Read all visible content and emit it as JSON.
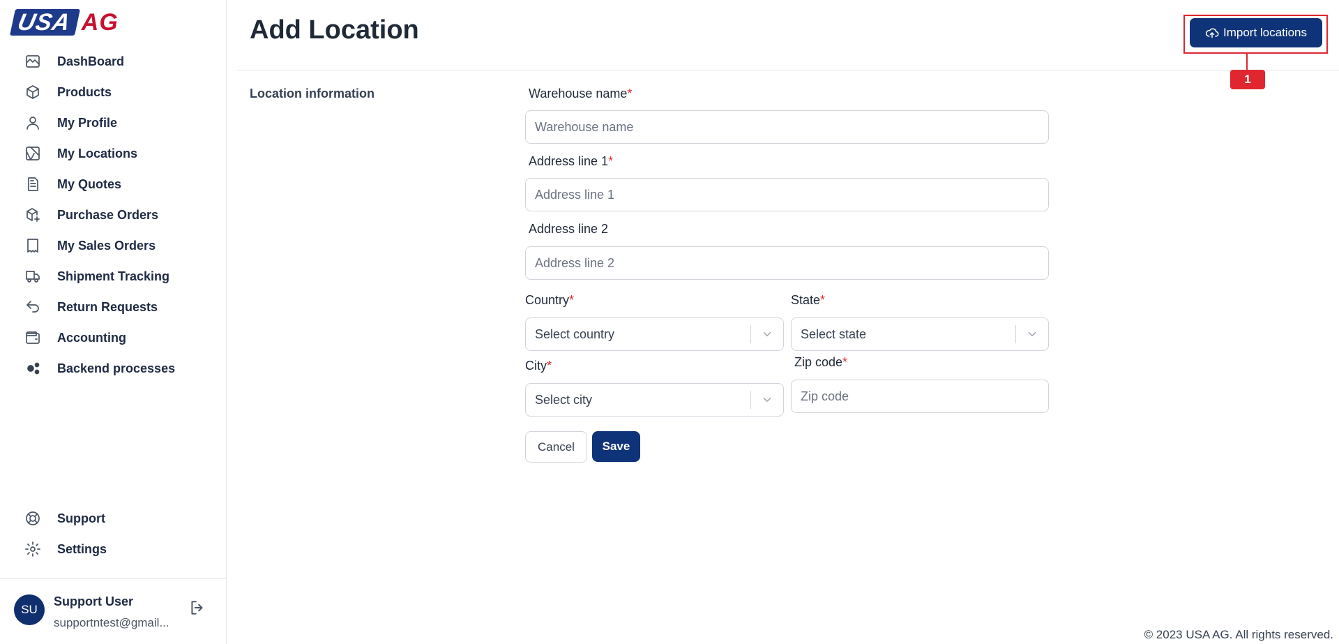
{
  "brand": {
    "logo_left": "USA",
    "logo_right": "AG"
  },
  "sidebar": {
    "items": [
      {
        "label": "DashBoard",
        "icon": "chart-line-icon"
      },
      {
        "label": "Products",
        "icon": "cube-icon"
      },
      {
        "label": "My Profile",
        "icon": "user-icon"
      },
      {
        "label": "My Locations",
        "icon": "map-icon"
      },
      {
        "label": "My Quotes",
        "icon": "document-icon"
      },
      {
        "label": "Purchase Orders",
        "icon": "package-plus-icon"
      },
      {
        "label": "My Sales Orders",
        "icon": "receipt-icon"
      },
      {
        "label": "Shipment Tracking",
        "icon": "truck-icon"
      },
      {
        "label": "Return Requests",
        "icon": "return-arrow-icon"
      },
      {
        "label": "Accounting",
        "icon": "wallet-icon"
      },
      {
        "label": "Backend processes",
        "icon": "gears-icon"
      }
    ],
    "bottom_items": [
      {
        "label": "Support",
        "icon": "lifebuoy-icon"
      },
      {
        "label": "Settings",
        "icon": "gear-icon"
      }
    ],
    "user": {
      "initials": "SU",
      "name": "Support User",
      "email": "supportntest@gmail..."
    }
  },
  "header": {
    "title": "Add Location",
    "import_label": "Import locations",
    "annotation_number": "1"
  },
  "form": {
    "section_label": "Location information",
    "warehouse": {
      "label": "Warehouse name",
      "placeholder": "Warehouse name"
    },
    "address1": {
      "label": "Address line 1",
      "placeholder": "Address line 1"
    },
    "address2": {
      "label": "Address line 2",
      "placeholder": "Address line 2"
    },
    "country": {
      "label": "Country",
      "placeholder": "Select country"
    },
    "state": {
      "label": "State",
      "placeholder": "Select state"
    },
    "city": {
      "label": "City",
      "placeholder": "Select city"
    },
    "zip": {
      "label": "Zip code",
      "placeholder": "Zip code"
    },
    "required_mark": "*",
    "cancel_label": "Cancel",
    "save_label": "Save"
  },
  "footer": {
    "copyright": "© 2023 USA AG. All rights reserved."
  },
  "colors": {
    "primary": "#0f3378",
    "required": "#e0262f",
    "highlight": "#e0262f"
  }
}
